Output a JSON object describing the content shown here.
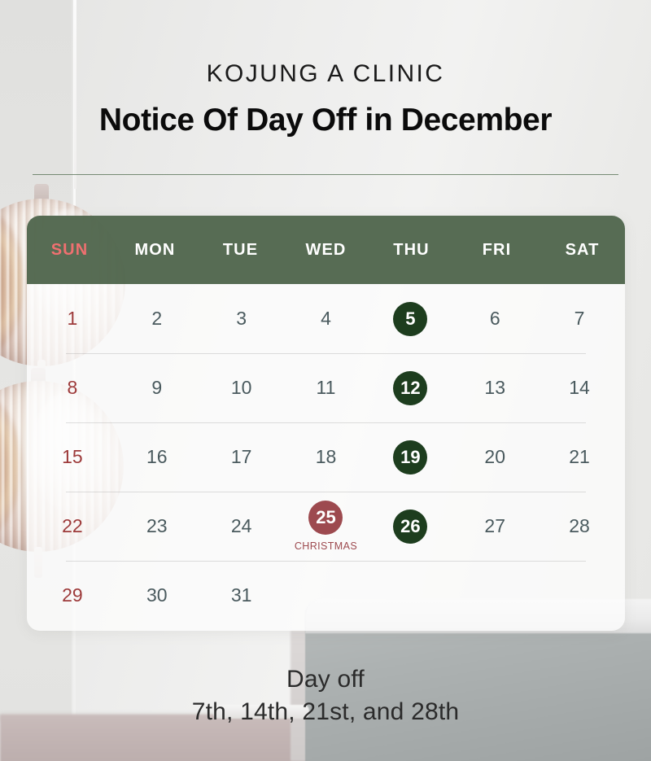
{
  "header": {
    "clinic_name": "KOJUNG A CLINIC",
    "notice_title": "Notice Of Day Off in December"
  },
  "calendar": {
    "weekday_headers": [
      {
        "label": "SUN",
        "accent": "#ef7070"
      },
      {
        "label": "MON",
        "accent": "#ffffff"
      },
      {
        "label": "TUE",
        "accent": "#ffffff"
      },
      {
        "label": "WED",
        "accent": "#ffffff"
      },
      {
        "label": "THU",
        "accent": "#ffffff"
      },
      {
        "label": "FRI",
        "accent": "#ffffff"
      },
      {
        "label": "SAT",
        "accent": "#ffffff"
      }
    ],
    "weeks": [
      [
        {
          "day": "1",
          "kind": "sunday"
        },
        {
          "day": "2",
          "kind": "normal"
        },
        {
          "day": "3",
          "kind": "normal"
        },
        {
          "day": "4",
          "kind": "normal"
        },
        {
          "day": "5",
          "kind": "closed-green"
        },
        {
          "day": "6",
          "kind": "normal"
        },
        {
          "day": "7",
          "kind": "normal"
        }
      ],
      [
        {
          "day": "8",
          "kind": "sunday"
        },
        {
          "day": "9",
          "kind": "normal"
        },
        {
          "day": "10",
          "kind": "normal"
        },
        {
          "day": "11",
          "kind": "normal"
        },
        {
          "day": "12",
          "kind": "closed-green"
        },
        {
          "day": "13",
          "kind": "normal"
        },
        {
          "day": "14",
          "kind": "normal"
        }
      ],
      [
        {
          "day": "15",
          "kind": "sunday"
        },
        {
          "day": "16",
          "kind": "normal"
        },
        {
          "day": "17",
          "kind": "normal"
        },
        {
          "day": "18",
          "kind": "normal"
        },
        {
          "day": "19",
          "kind": "closed-green"
        },
        {
          "day": "20",
          "kind": "normal"
        },
        {
          "day": "21",
          "kind": "normal"
        }
      ],
      [
        {
          "day": "22",
          "kind": "sunday"
        },
        {
          "day": "23",
          "kind": "normal"
        },
        {
          "day": "24",
          "kind": "normal"
        },
        {
          "day": "25",
          "kind": "holiday-red",
          "sublabel": "CHRISTMAS"
        },
        {
          "day": "26",
          "kind": "closed-green"
        },
        {
          "day": "27",
          "kind": "normal"
        },
        {
          "day": "28",
          "kind": "normal"
        }
      ],
      [
        {
          "day": "29",
          "kind": "sunday"
        },
        {
          "day": "30",
          "kind": "normal"
        },
        {
          "day": "31",
          "kind": "normal"
        },
        {
          "day": "",
          "kind": "empty"
        },
        {
          "day": "",
          "kind": "empty"
        },
        {
          "day": "",
          "kind": "empty"
        },
        {
          "day": "",
          "kind": "empty"
        }
      ]
    ]
  },
  "footer": {
    "line1": "Day off",
    "line2": "7th, 14th, 21st, and 28th"
  },
  "colors": {
    "header_green": "#40583c",
    "marker_green": "#1d3d1e",
    "marker_red": "#9d4a4f",
    "sunday_red": "#9d3a3a",
    "weekday_text": "#4a5a5e",
    "sun_header": "#ef7070",
    "rule_green": "#4f6b4d"
  }
}
